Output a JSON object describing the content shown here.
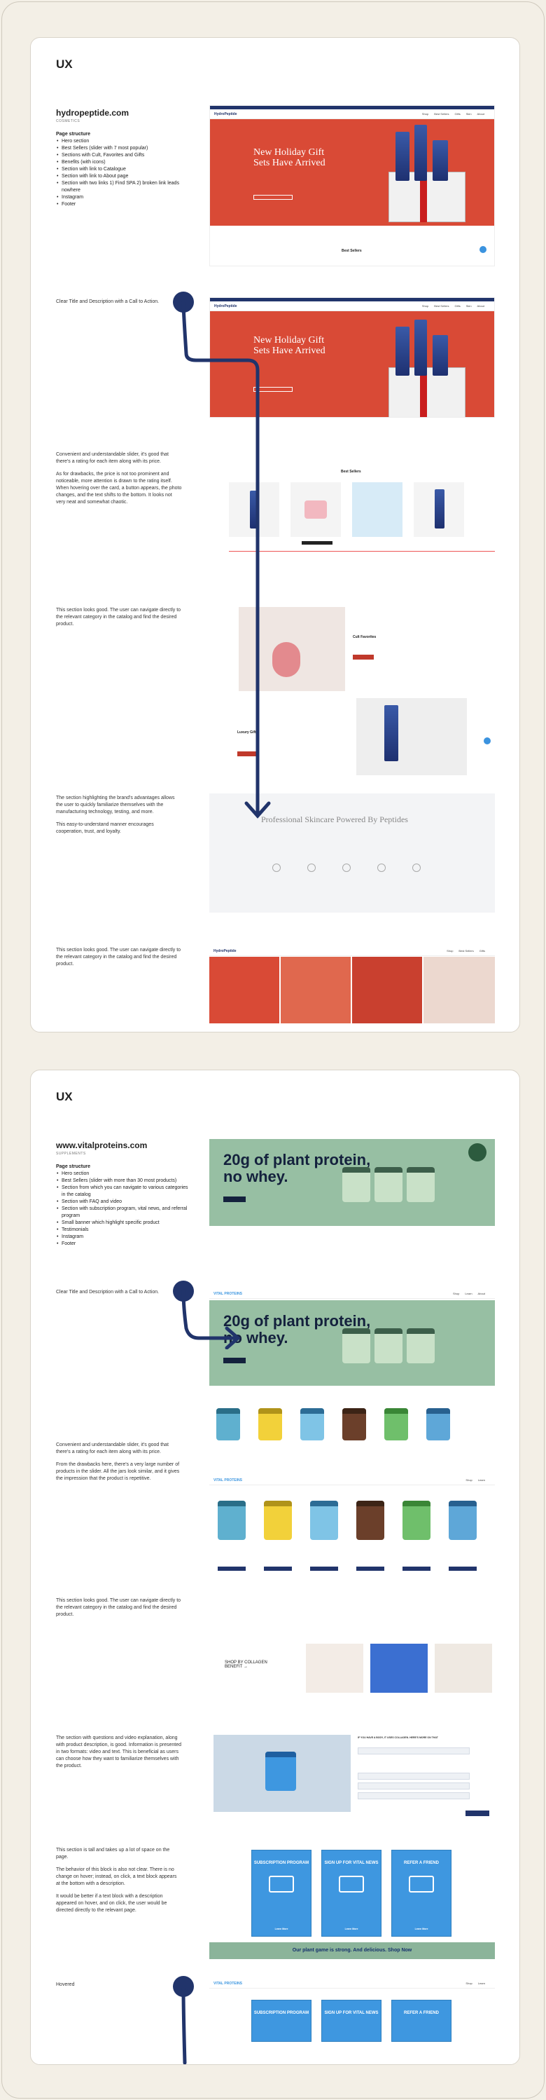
{
  "sections": [
    {
      "ux_title": "UX",
      "site_name": "hydropeptide.com",
      "site_type": "COSMETICS",
      "structure_heading": "Page structure",
      "structure_items": [
        "Hero section",
        "Best Sellers (slider with 7 most popular)",
        "Sections with Cult, Favorites and Gifts",
        "Benefits (with icons)",
        "Section with link to Catalogue",
        "Section with link to About page",
        "Section with two links 1) Find SPA 2) broken link leads nowhere",
        "Instagram",
        "Footer"
      ],
      "notes": [
        {
          "paragraphs": [
            "Clear Title and Description with a Call to Action."
          ]
        },
        {
          "paragraphs": [
            "Convenient and understandable slider, it's good that there's a rating for each item along with its price.",
            "As for drawbacks, the price is not too prominent and noticeable, more attention is drawn to the rating itself. When hovering over the card, a button appears, the photo changes, and the text shifts to the bottom. It looks not very neat and somewhat chaotic."
          ]
        },
        {
          "paragraphs": [
            "This section looks good. The user can navigate directly to the relevant category in the catalog and find the desired product."
          ]
        },
        {
          "paragraphs": [
            "The section highlighting the brand's advantages allows the user to quickly familiarize themselves with the manufacturing technology, testing, and more.",
            "This easy-to-understand manner encourages cooperation, trust, and loyalty."
          ]
        },
        {
          "paragraphs": [
            "This section looks good. The user can navigate directly to the relevant category in the catalog and find the desired product."
          ]
        }
      ],
      "shots": {
        "hero_heading": "New Holiday Gift Sets Have Arrived",
        "best_sellers": "Best Sellers",
        "cult_favorites": "Cult Favorites",
        "luxury_gifts": "Luxury Gifts",
        "benefits_heading": "Professional Skincare Powered By Peptides",
        "logo": "HydroPeptide"
      }
    },
    {
      "ux_title": "UX",
      "site_name": "www.vitalproteins.com",
      "site_type": "SUPPLEMENTS",
      "structure_heading": "Page structure",
      "structure_items": [
        "Hero section",
        "Best Sellers (slider with more than 30 most products)",
        "Section from which you can navigate to various categories in the catalog",
        "Section with FAQ and video",
        "Section with subscription program, vital news, and referral program",
        "Small banner which highlight specific product",
        "Testimonials",
        "Instagram",
        "Footer"
      ],
      "notes": [
        {
          "paragraphs": [
            "Clear Title and Description with a Call to Action."
          ]
        },
        {
          "paragraphs": [
            "Convenient and understandable slider, it's good that there's a rating for each item along with its price.",
            "From the drawbacks here, there's a very large number of products in the slider. All the jars look similar, and it gives the impression that the product is repetitive."
          ]
        },
        {
          "paragraphs": [
            "This section looks good. The user can navigate directly to the relevant category in the catalog and find the desired product."
          ]
        },
        {
          "paragraphs": [
            "The section with questions and video explanation, along with product description, is good. Information is presented in two formats: video and text. This is beneficial as users can choose how they want to familiarize themselves with the product."
          ]
        },
        {
          "paragraphs": [
            "This section is tall and takes up a lot of space on the page.",
            "The behavior of this block is also not clear. There is no change on hover; instead, on click, a text block appears at the bottom with a description.",
            "It would be better if a text block with a description appeared on hover, and on click, the user would be directed directly to the relevant page."
          ]
        },
        {
          "paragraphs": [
            "Hovered"
          ]
        }
      ],
      "shots": {
        "hero_heading": "20g of plant protein, no whey.",
        "shop_by": "SHOP BY COLLAGEN BENEFIT →",
        "faq_heading": "IF YOU HAVE A BODY, IT USES COLLAGEN. HERE'S MORE ON THAT",
        "box1": "SUBSCRIPTION PROGRAM",
        "box2": "SIGN UP FOR VITAL NEWS",
        "box3": "REFER A FRIEND",
        "learn_more": "Learn More",
        "strip": "Our plant game is strong. And delicious. Shop Now",
        "logo": "VITAL PROTEINS"
      }
    }
  ]
}
